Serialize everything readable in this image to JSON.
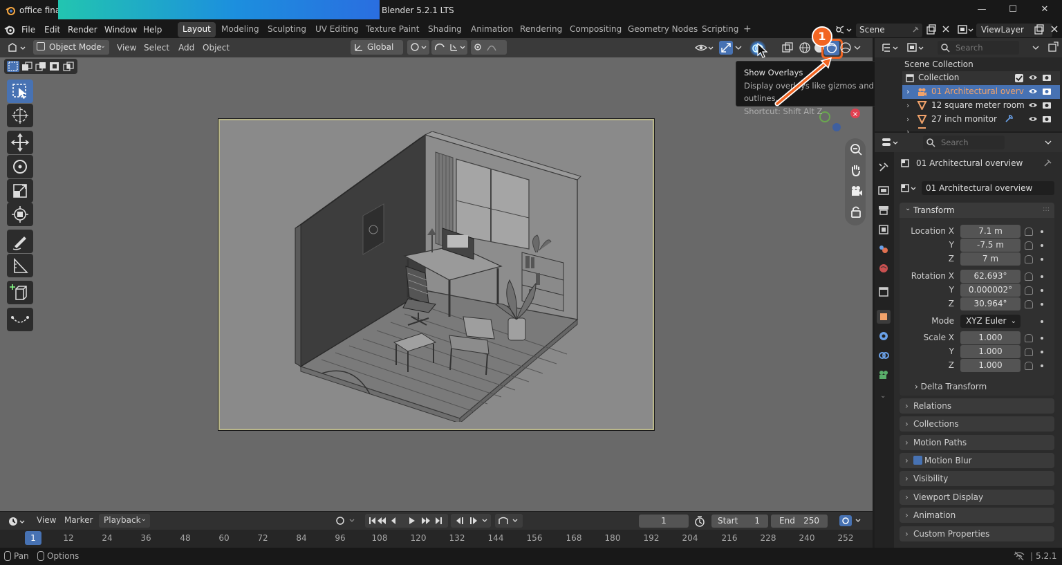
{
  "window": {
    "doc_title": "office final",
    "app_title": "Blender 5.2.1 LTS",
    "minimize": "—",
    "maximize": "☐",
    "close": "✕"
  },
  "menu": [
    "File",
    "Edit",
    "Render",
    "Window",
    "Help"
  ],
  "workspaces": [
    "Layout",
    "Modeling",
    "Sculpting",
    "UV Editing",
    "Texture Paint",
    "Shading",
    "Animation",
    "Rendering",
    "Compositing",
    "Geometry Nodes",
    "Scripting"
  ],
  "workspace_add": "+",
  "scene": {
    "label": "Scene",
    "viewlayer": "ViewLayer"
  },
  "viewport_header": {
    "mode": "Object Mode",
    "menus": [
      "View",
      "Select",
      "Add",
      "Object"
    ],
    "orientation": "Global"
  },
  "tooltip": {
    "title": "Show Overlays",
    "description": "Display overlays like gizmos and outlines.",
    "shortcut": "Shortcut: Shift Alt Z"
  },
  "annotation": {
    "step": "1",
    "color": "#f26522"
  },
  "outliner": {
    "search_placeholder": "Search",
    "scene_collection": "Scene Collection",
    "rows": [
      {
        "name": "Collection",
        "selected": false
      },
      {
        "name": "01 Architectural overv",
        "selected": true
      },
      {
        "name": "12 square meter room",
        "selected": false
      },
      {
        "name": "27 inch monitor",
        "selected": false
      }
    ]
  },
  "properties": {
    "search_placeholder": "Search",
    "object_name": "01 Architectural overview",
    "data_name": "01 Architectural overview",
    "transform_title": "Transform",
    "location": {
      "label": "Location X",
      "x": "7.1 m",
      "y": "-7.5 m",
      "z": "7 m"
    },
    "rotation": {
      "label": "Rotation X",
      "x": "62.693°",
      "y": "0.000002°",
      "z": "30.964°"
    },
    "mode": {
      "label": "Mode",
      "value": "XYZ Euler"
    },
    "scale": {
      "label": "Scale X",
      "x": "1.000",
      "y": "1.000",
      "z": "1.000"
    },
    "axis_y": "Y",
    "axis_z": "Z",
    "delta": "Delta Transform",
    "panels": [
      "Relations",
      "Collections",
      "Motion Paths",
      "Motion Blur",
      "Visibility",
      "Viewport Display",
      "Animation",
      "Custom Properties"
    ]
  },
  "timeline": {
    "menus": [
      "View",
      "Marker",
      "Playback"
    ],
    "current_frame": "1",
    "start_label": "Start",
    "start": "1",
    "end_label": "End",
    "end": "250",
    "ruler": [
      "1",
      "12",
      "24",
      "36",
      "48",
      "60",
      "72",
      "84",
      "96",
      "108",
      "120",
      "132",
      "144",
      "156",
      "168",
      "180",
      "192",
      "204",
      "216",
      "228",
      "240",
      "252"
    ]
  },
  "status": {
    "pan": "Pan",
    "options": "Options",
    "version": "5.2.1"
  }
}
